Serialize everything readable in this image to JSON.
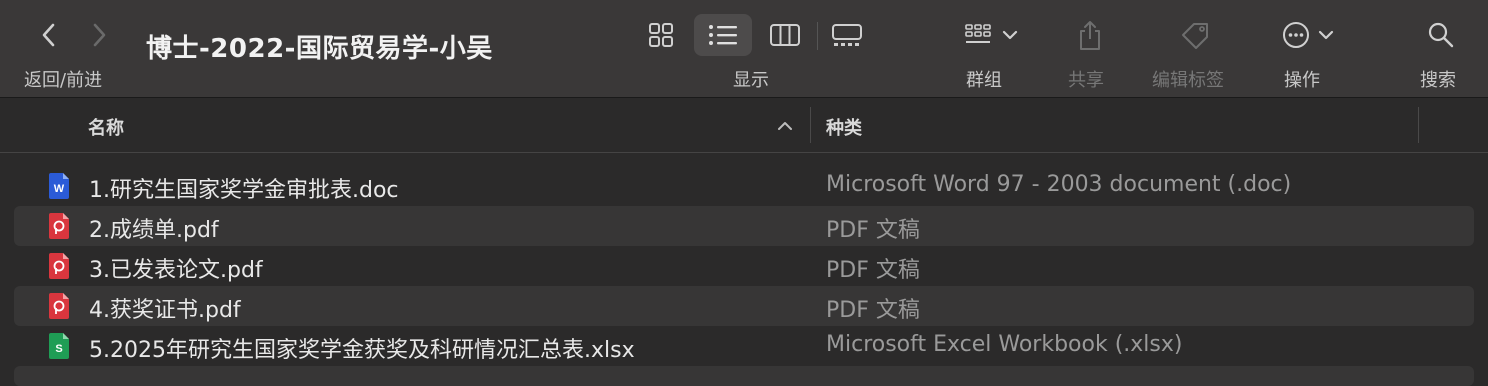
{
  "window": {
    "title": "博士-2022-国际贸易学-小吴"
  },
  "toolbar": {
    "nav_label": "返回/前进",
    "view_label": "显示",
    "group_label": "群组",
    "share_label": "共享",
    "tags_label": "编辑标签",
    "action_label": "操作",
    "search_label": "搜索",
    "icons": {
      "back": "chevron-left-icon",
      "forward": "chevron-right-icon",
      "icon_view": "grid-icon",
      "list_view": "list-icon",
      "column_view": "columns-icon",
      "gallery_view": "gallery-icon",
      "group": "group-grid-icon",
      "share": "share-icon",
      "tag": "tag-icon",
      "action": "ellipsis-circle-icon",
      "search": "magnifier-icon"
    }
  },
  "columns": {
    "name": "名称",
    "kind": "种类",
    "sort": "ascending"
  },
  "files": [
    {
      "name": "1.研究生国家奖学金审批表.doc",
      "kind": "Microsoft Word 97 - 2003 document (.doc)",
      "icon": "word-doc-icon",
      "color": "#2b5bd7"
    },
    {
      "name": "2.成绩单.pdf",
      "kind": "PDF 文稿",
      "icon": "pdf-icon",
      "color": "#d9363e"
    },
    {
      "name": "3.已发表论文.pdf",
      "kind": "PDF 文稿",
      "icon": "pdf-icon",
      "color": "#d9363e"
    },
    {
      "name": "4.获奖证书.pdf",
      "kind": "PDF 文稿",
      "icon": "pdf-icon",
      "color": "#d9363e"
    },
    {
      "name": "5.2025年研究生国家奖学金获奖及科研情况汇总表.xlsx",
      "kind": "Microsoft Excel Workbook (.xlsx)",
      "icon": "excel-xlsx-icon",
      "color": "#1f9d55"
    }
  ]
}
